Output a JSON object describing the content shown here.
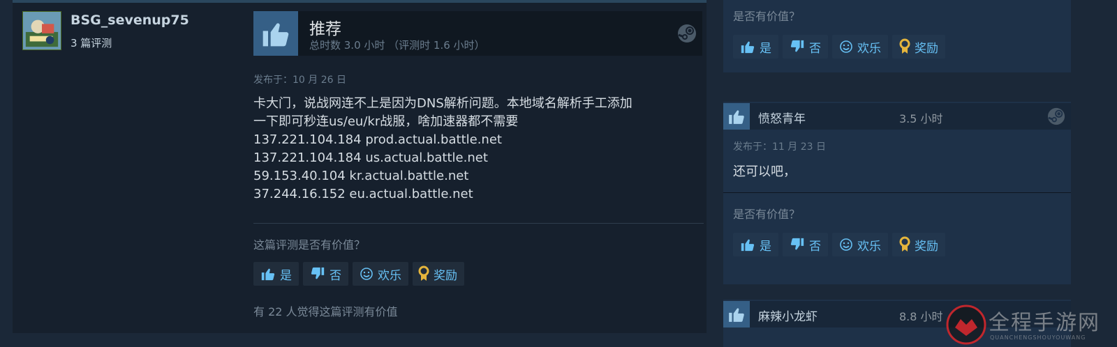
{
  "review": {
    "author": "BSG_sevenup75",
    "review_count": "3 篇评测",
    "verdict": "推荐",
    "hours": "总时数 3.0 小时 （评测时 1.6 小时）",
    "posted": "发布于：10 月 26 日",
    "lines": [
      "卡大门，说战网连不上是因为DNS解析问题。本地域名解析手工添加",
      "一下即可秒连us/eu/kr战服，啥加速器都不需要",
      "137.221.104.184 prod.actual.battle.net",
      "137.221.104.184 us.actual.battle.net",
      "59.153.40.104 kr.actual.battle.net",
      "37.244.16.152 eu.actual.battle.net"
    ],
    "helpful_question": "这篇评测是否有价值？",
    "buttons": {
      "yes": "是",
      "no": "否",
      "funny": "欢乐",
      "award": "奖励"
    },
    "helpful_count": "有 22 人觉得这篇评测有价值"
  },
  "side": {
    "card1": {
      "question": "是否有价值？"
    },
    "card2": {
      "author": "愤怒青年",
      "hours": "3.5 小时",
      "posted": "发布于：11 月 23 日",
      "text": "还可以吧，",
      "question": "是否有价值？"
    },
    "card3": {
      "author": "麻辣小龙虾",
      "hours": "8.8 小时"
    },
    "buttons": {
      "yes": "是",
      "no": "否",
      "funny": "欢乐",
      "award": "奖励"
    }
  },
  "watermark": {
    "title": "全程手游网",
    "subtitle": "QUANCHENGSHOUYOUWANG"
  },
  "colors": {
    "bg": "#1b2838",
    "link": "#67c1f5",
    "thumb_bg": "#355f86",
    "award": "#e5b53c"
  },
  "icons": {
    "thumb_up": "thumbs-up-icon",
    "thumb_down": "thumbs-down-icon",
    "funny": "smiley-icon",
    "award": "award-ribbon-icon",
    "steam": "steam-icon"
  }
}
